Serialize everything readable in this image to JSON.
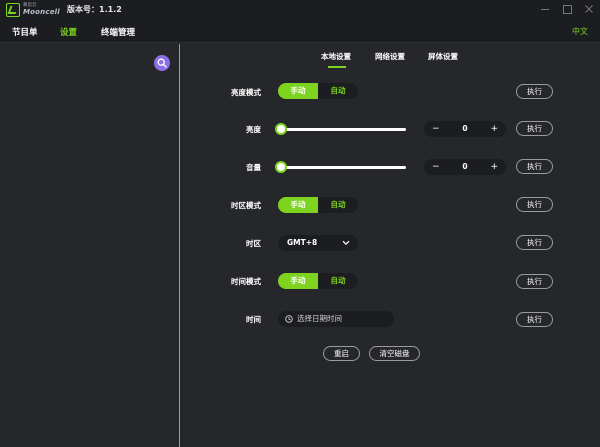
{
  "app": {
    "logo_cn": "慕思云",
    "logo_en": "Mooncell",
    "version": "版本号：1.1.2"
  },
  "menu": {
    "items": [
      {
        "label": "节目单"
      },
      {
        "label": "设置"
      },
      {
        "label": "终端管理"
      }
    ],
    "active": "设置",
    "language": "中文"
  },
  "tabs": [
    {
      "label": "本地设置"
    },
    {
      "label": "网络设置"
    },
    {
      "label": "屏体设置"
    }
  ],
  "active_tab": "本地设置",
  "colors": {
    "accent": "#7ed321",
    "search": "#8e6ee6",
    "background": "#26272b",
    "bar": "#1c1d20"
  },
  "settings": {
    "brightness_mode": {
      "label": "亮度模式",
      "manual": "手动",
      "auto": "自动",
      "selected": "手动"
    },
    "brightness": {
      "label": "亮度",
      "value": "0",
      "slider_fraction": 0
    },
    "volume": {
      "label": "音量",
      "value": "0",
      "slider_fraction": 0
    },
    "timezone_mode": {
      "label": "时区模式",
      "manual": "手动",
      "auto": "自动",
      "selected": "手动"
    },
    "timezone": {
      "label": "时区",
      "value": "GMT+8"
    },
    "time_mode": {
      "label": "时间模式",
      "manual": "手动",
      "auto": "自动",
      "selected": "手动"
    },
    "time": {
      "label": "时间",
      "placeholder": "选择日期时间"
    }
  },
  "stepper": {
    "minus": "−",
    "plus": "+"
  },
  "execute_label": "执行",
  "actions": {
    "restart": "重启",
    "clear_disk": "清空磁盘"
  }
}
